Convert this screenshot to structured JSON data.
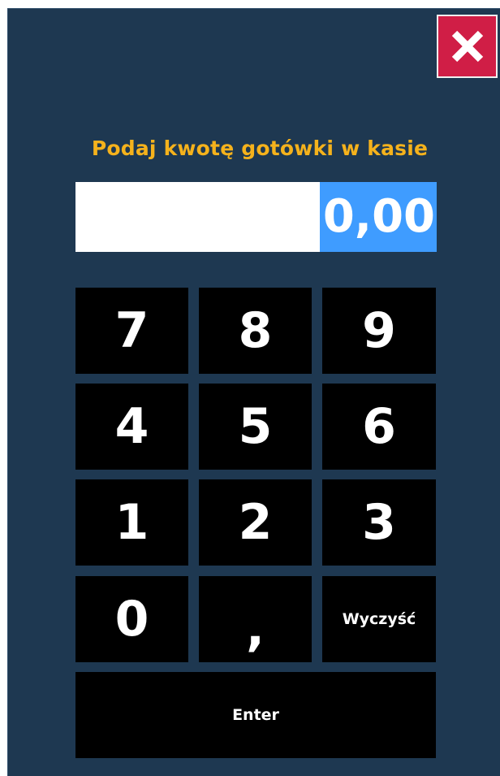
{
  "dialog": {
    "prompt": "Podaj kwotę gotówki w kasie",
    "close_label": "X",
    "amount_value": "0,00"
  },
  "keypad": {
    "k7": "7",
    "k8": "8",
    "k9": "9",
    "k4": "4",
    "k5": "5",
    "k6": "6",
    "k1": "1",
    "k2": "2",
    "k3": "3",
    "k0": "0",
    "comma": ",",
    "clear": "Wyczyść",
    "enter": "Enter"
  },
  "colors": {
    "background": "#1e3851",
    "prompt_text": "#f5b21c",
    "close_button": "#d01e46",
    "selection": "#3f9cff",
    "key": "#000000"
  }
}
